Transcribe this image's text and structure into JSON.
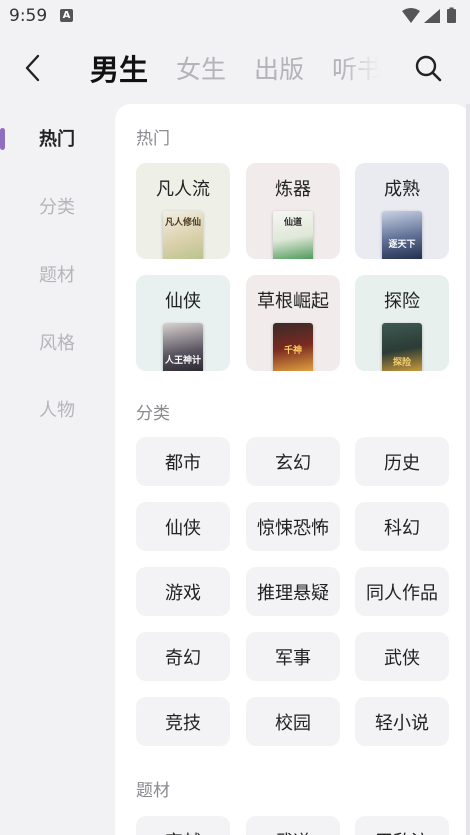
{
  "status_bar": {
    "time": "9:59",
    "notification_letter": "A"
  },
  "header": {
    "tabs": [
      {
        "label": "男生",
        "active": true
      },
      {
        "label": "女生",
        "active": false
      },
      {
        "label": "出版",
        "active": false
      },
      {
        "label": "听书",
        "active": false
      }
    ]
  },
  "sidebar": {
    "items": [
      {
        "label": "热门",
        "active": true
      },
      {
        "label": "分类",
        "active": false
      },
      {
        "label": "题材",
        "active": false
      },
      {
        "label": "风格",
        "active": false
      },
      {
        "label": "人物",
        "active": false
      }
    ]
  },
  "hot": {
    "title": "热门",
    "cards": [
      {
        "label": "凡人流",
        "cover_text": "凡人修仙",
        "bg": "#eef0e8"
      },
      {
        "label": "炼器",
        "cover_text": "仙道",
        "bg": "#f1ebeb"
      },
      {
        "label": "成熟",
        "cover_text": "逐天下",
        "bg": "#eaeaf1"
      },
      {
        "label": "仙侠",
        "cover_text": "人王神计",
        "bg": "#e8f0f0"
      },
      {
        "label": "草根崛起",
        "cover_text": "千神",
        "bg": "#f1ebeb"
      },
      {
        "label": "探险",
        "cover_text": "探险",
        "bg": "#e8f0ee"
      }
    ]
  },
  "category": {
    "title": "分类",
    "items": [
      "都市",
      "玄幻",
      "历史",
      "仙侠",
      "惊悚恐怖",
      "科幻",
      "游戏",
      "推理悬疑",
      "同人作品",
      "奇幻",
      "军事",
      "武侠",
      "竞技",
      "校园",
      "轻小说"
    ]
  },
  "theme": {
    "title": "题材",
    "items": [
      "穿越",
      "武道",
      "无敌流"
    ]
  }
}
